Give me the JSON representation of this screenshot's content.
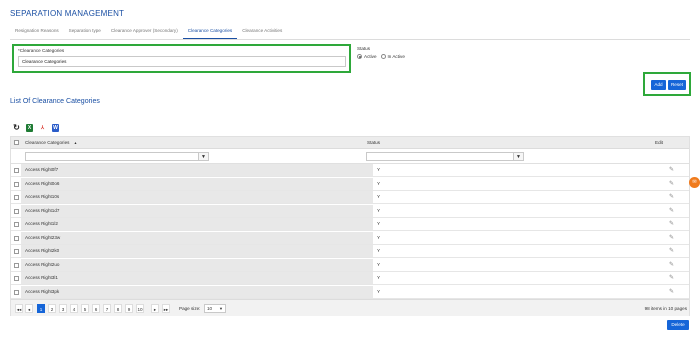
{
  "page": {
    "title": "SEPARATION MANAGEMENT"
  },
  "tabs": [
    {
      "label": "Resignation Reasons",
      "active": false
    },
    {
      "label": "Separation type",
      "active": false
    },
    {
      "label": "Clearance Approver (Secondary)",
      "active": false
    },
    {
      "label": "Clearance Categories",
      "active": true
    },
    {
      "label": "Clearance Activities",
      "active": false
    }
  ],
  "form": {
    "field_label": "*Clearance Categories",
    "field_value": "Clearance Categories",
    "status_label": "Status",
    "status_options": [
      {
        "label": "Active",
        "selected": true
      },
      {
        "label": "In Active",
        "selected": false
      }
    ],
    "add_label": "Add",
    "reset_label": "Reset"
  },
  "list": {
    "title": "List Of Clearance Categories",
    "toolbar_icons": [
      "refresh-icon",
      "excel-icon",
      "pdf-icon",
      "word-icon"
    ],
    "columns": {
      "name": "Clearance Categories",
      "sort_indicator": "▲",
      "status": "Status",
      "edit": "Edit"
    },
    "filter_icon": "filter-icon",
    "rows": [
      {
        "name": "Access Right0f7",
        "status": "Y"
      },
      {
        "name": "Access Right0o6",
        "status": "Y"
      },
      {
        "name": "Access Right10s",
        "status": "Y"
      },
      {
        "name": "Access Right1d7",
        "status": "Y"
      },
      {
        "name": "Access Right1l2",
        "status": "Y"
      },
      {
        "name": "Access Right23w",
        "status": "Y"
      },
      {
        "name": "Access Right2k0",
        "status": "Y"
      },
      {
        "name": "Access Right2uo",
        "status": "Y"
      },
      {
        "name": "Access Right3l1",
        "status": "Y"
      },
      {
        "name": "Access Right3pk",
        "status": "Y"
      }
    ],
    "pager": {
      "first": "◂◂",
      "prev": "◂",
      "pages": [
        "1",
        "2",
        "3",
        "4",
        "5",
        "6",
        "7",
        "8",
        "9",
        "10"
      ],
      "next_more": "▸",
      "last": "▸▸",
      "current_page": "1",
      "page_size_label": "Page size:",
      "page_size": "10",
      "items_info": "98 items in 10 pages"
    },
    "delete_label": "Delete"
  },
  "colors": {
    "accent": "#1565d8",
    "highlight_border": "#2ea83a",
    "title": "#1a4fa3"
  }
}
